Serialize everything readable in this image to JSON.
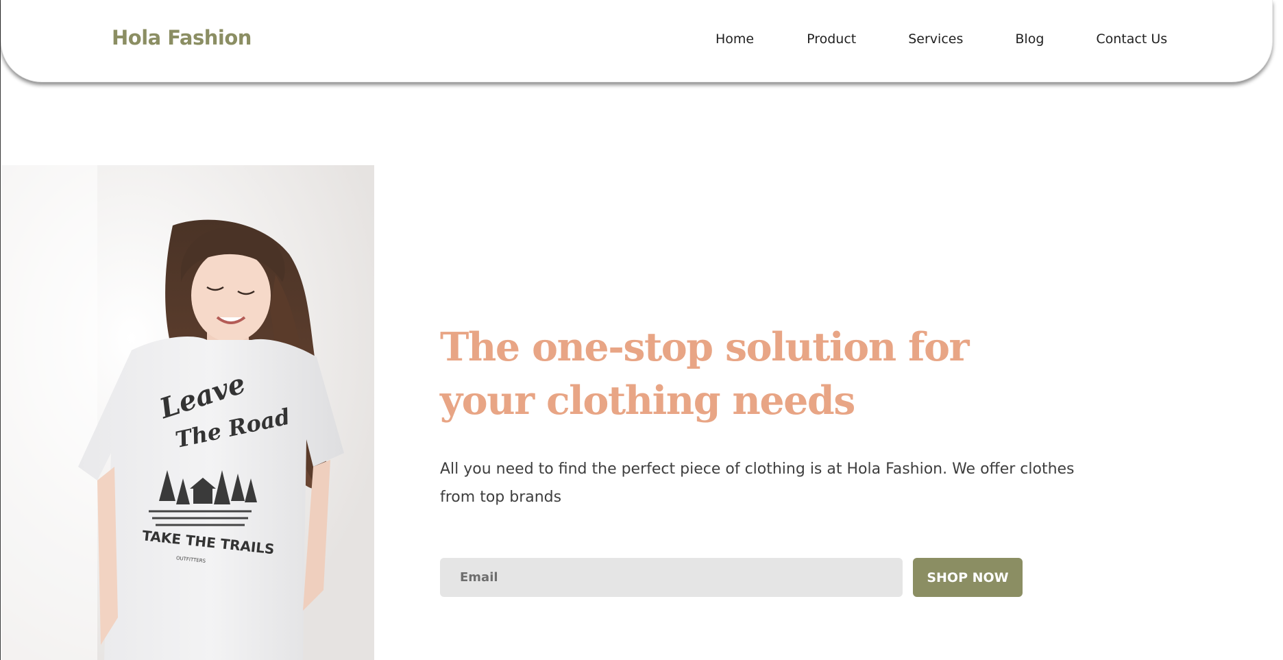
{
  "header": {
    "brand": "Hola Fashion",
    "nav": [
      "Home",
      "Product",
      "Services",
      "Blog",
      "Contact Us"
    ]
  },
  "hero": {
    "image_alt": "Woman in a white t-shirt printed with \"Leave The Road, Take The Trails\"",
    "shirt_print": {
      "line1": "Leave",
      "line2": "The Road",
      "line3": "TAKE THE TRAILS",
      "line4": "OUTFITTERS"
    },
    "headline": "The one-stop solution for your clothing needs",
    "subtext": "All you need to find the perfect piece of clothing is at Hola Fashion. We offer clothes from top brands",
    "email_placeholder": "Email",
    "cta_label": "SHOP NOW"
  },
  "colors": {
    "brand_olive": "#8b8e63",
    "headline_peach": "#e8a585",
    "input_gray": "#e5e5e5"
  }
}
